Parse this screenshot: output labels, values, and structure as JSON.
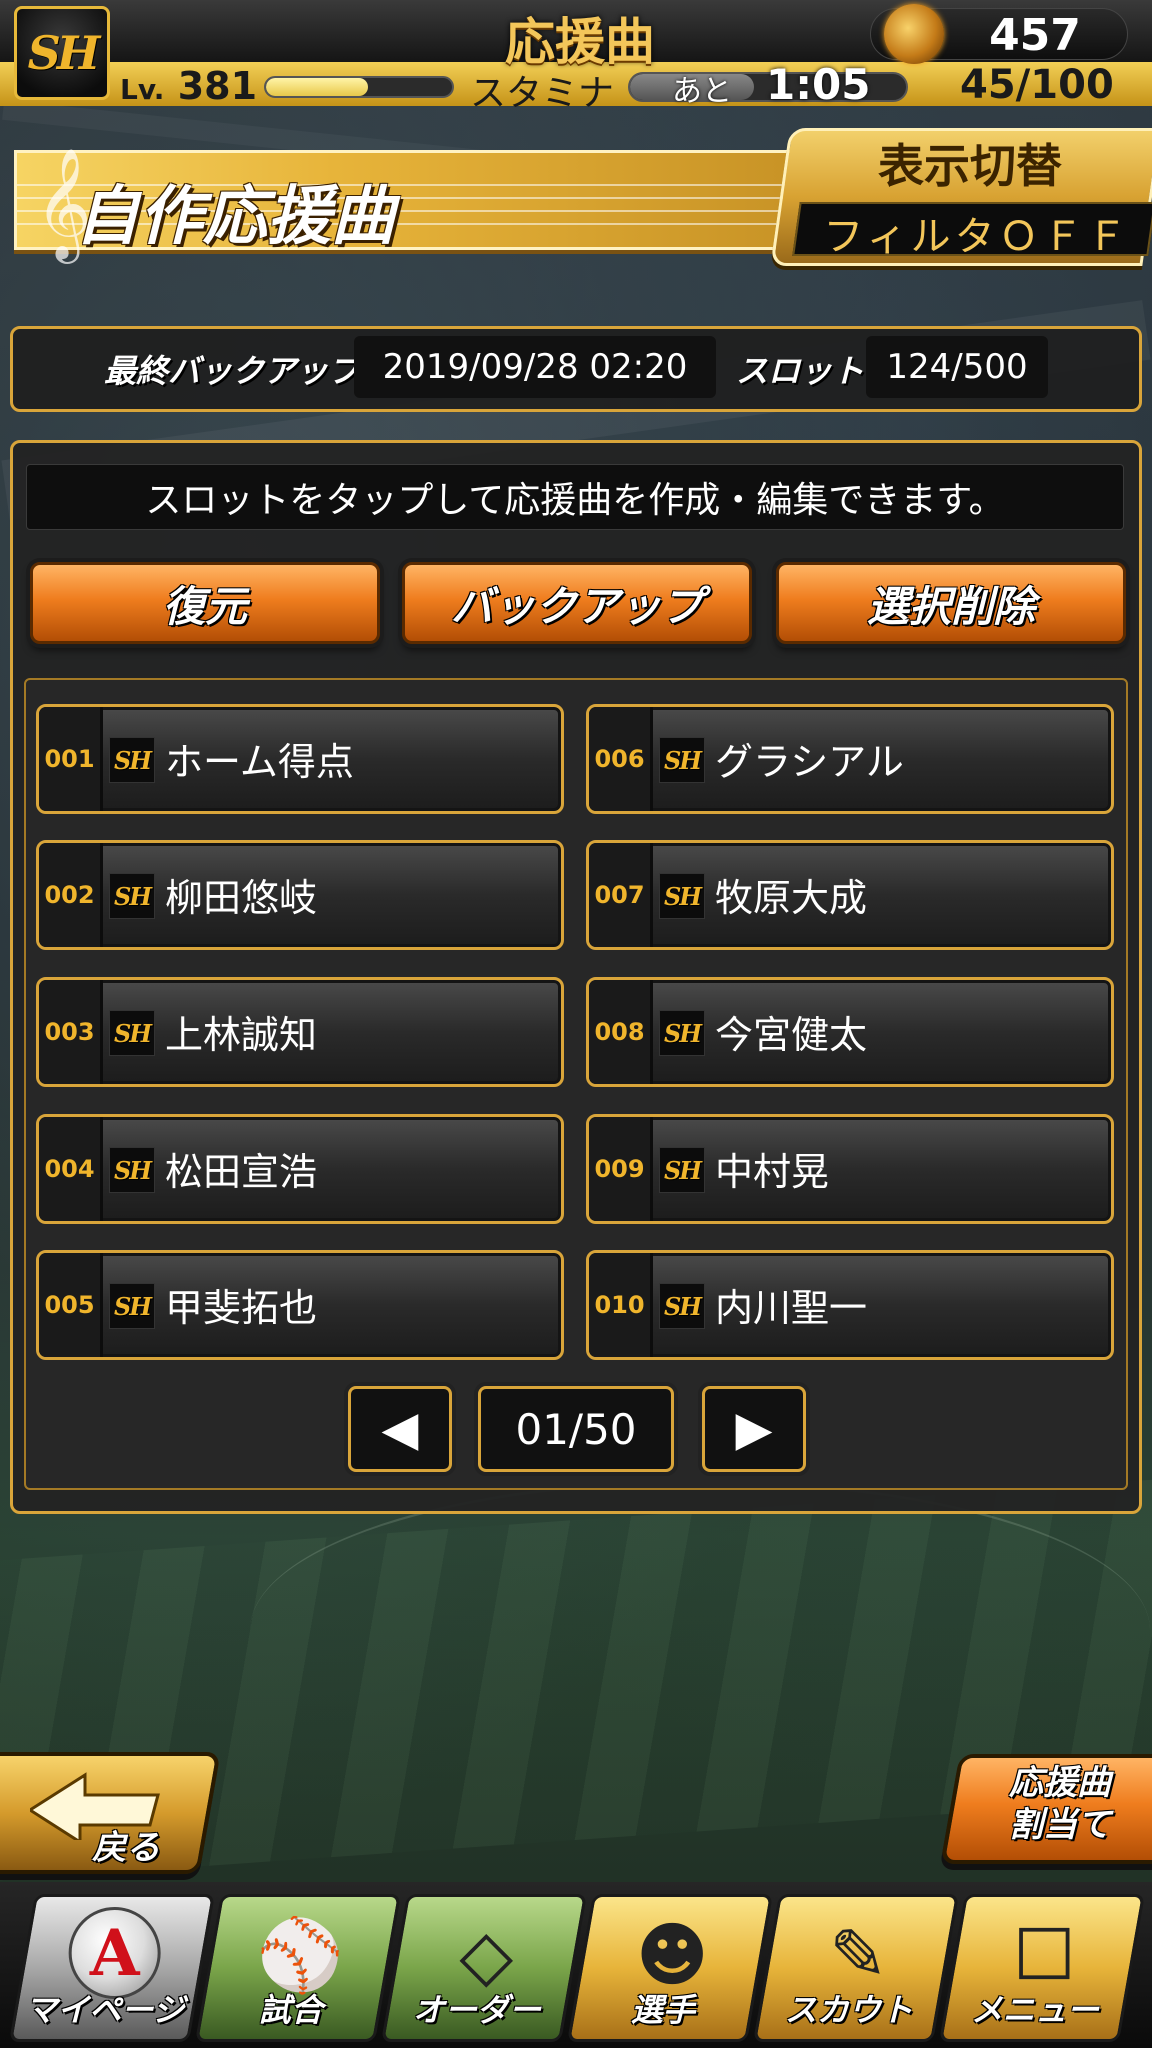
{
  "header": {
    "title": "応援曲",
    "points": "457",
    "level_prefix": "Lv.",
    "level": "381",
    "exp_fraction": 0.55,
    "stamina_label": "スタミナ",
    "stamina_fraction": 0.45,
    "remaining_label": "あと",
    "timer": "1:05",
    "stamina_value": "45/100",
    "team_logo": "SH"
  },
  "banner": {
    "title": "自作応援曲",
    "clef_icon": "𝄞",
    "display_switch_label": "表示切替",
    "filter_status": "フィルタＯＦＦ"
  },
  "backup_info": {
    "last_backup_label": "最終バックアップ",
    "last_backup_value": "2019/09/28 02:20",
    "slot_label": "スロット",
    "slot_value": "124/500"
  },
  "hint": "スロットをタップして応援曲を作成・編集できます。",
  "actions": {
    "restore": "復元",
    "backup": "バックアップ",
    "delete_selected": "選択削除"
  },
  "slots": [
    {
      "num": "001",
      "name": "ホーム得点"
    },
    {
      "num": "002",
      "name": "柳田悠岐"
    },
    {
      "num": "003",
      "name": "上林誠知"
    },
    {
      "num": "004",
      "name": "松田宣浩"
    },
    {
      "num": "005",
      "name": "甲斐拓也"
    },
    {
      "num": "006",
      "name": "グラシアル"
    },
    {
      "num": "007",
      "name": "牧原大成"
    },
    {
      "num": "008",
      "name": "今宮健太"
    },
    {
      "num": "009",
      "name": "中村晃"
    },
    {
      "num": "010",
      "name": "内川聖一"
    }
  ],
  "pager": {
    "prev_icon": "◀",
    "next_icon": "▶",
    "current": "01/50"
  },
  "footer": {
    "back_label": "戻る",
    "assign_label_line1": "応援曲",
    "assign_label_line2": "割当て"
  },
  "nav": [
    {
      "label": "マイページ",
      "icon": "mypage-A-icon",
      "glyph": "A"
    },
    {
      "label": "試合",
      "icon": "stadium-icon",
      "glyph": "⚾"
    },
    {
      "label": "オーダー",
      "icon": "field-order-icon",
      "glyph": "◇"
    },
    {
      "label": "選手",
      "icon": "player-icon",
      "glyph": "☻"
    },
    {
      "label": "スカウト",
      "icon": "scout-card-icon",
      "glyph": "✎"
    },
    {
      "label": "メニュー",
      "icon": "menu-character-icon",
      "glyph": "☐"
    }
  ],
  "colors": {
    "accent_gold": "#d9a53a",
    "button_orange": "#ef7d1e",
    "slot_number": "#f0b52c"
  }
}
